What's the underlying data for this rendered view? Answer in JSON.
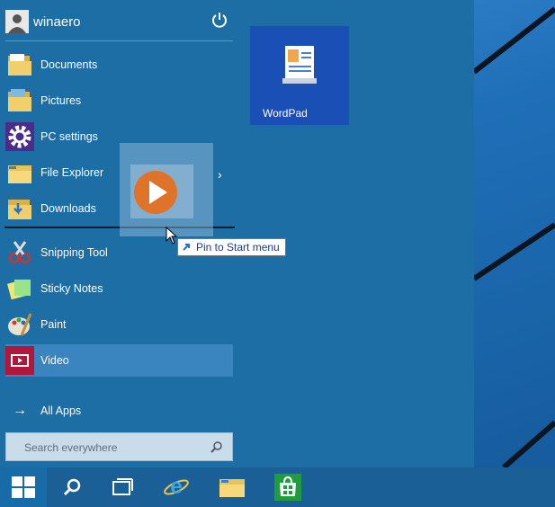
{
  "user": {
    "name": "winaero"
  },
  "menu_items": [
    {
      "label": "Documents",
      "icon": "documents-folder-icon"
    },
    {
      "label": "Pictures",
      "icon": "pictures-folder-icon"
    },
    {
      "label": "PC settings",
      "icon": "gear-icon"
    },
    {
      "label": "File Explorer",
      "icon": "file-explorer-icon"
    },
    {
      "label": "Downloads",
      "icon": "downloads-folder-icon"
    },
    {
      "label": "Snipping Tool",
      "icon": "snipping-tool-icon"
    },
    {
      "label": "Sticky Notes",
      "icon": "sticky-notes-icon"
    },
    {
      "label": "Paint",
      "icon": "paint-palette-icon"
    },
    {
      "label": "Video",
      "icon": "video-icon"
    }
  ],
  "all_apps_label": "All Apps",
  "search": {
    "placeholder": "Search everywhere"
  },
  "tiles": [
    {
      "label": "WordPad",
      "icon": "wordpad-icon"
    }
  ],
  "tooltip": {
    "label": "Pin to Start menu"
  },
  "taskbar": [
    {
      "name": "start-button",
      "icon": "windows-logo-icon"
    },
    {
      "name": "search-button",
      "icon": "search-icon"
    },
    {
      "name": "task-view-button",
      "icon": "task-view-icon"
    },
    {
      "name": "internet-explorer-button",
      "icon": "internet-explorer-icon"
    },
    {
      "name": "file-explorer-button",
      "icon": "folder-icon"
    },
    {
      "name": "store-button",
      "icon": "store-icon"
    }
  ],
  "colors": {
    "start_bg": "#1e6ea6",
    "taskbar_bg": "#1a5f96",
    "tile_bg": "#1a4fb5",
    "selected_bg": "#3a85bf"
  }
}
